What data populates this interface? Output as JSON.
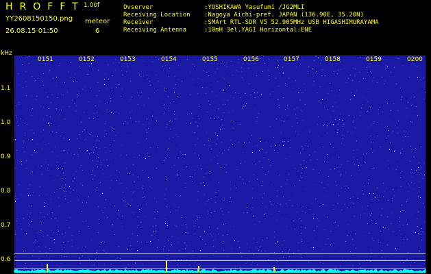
{
  "header": {
    "app_title": "HROFFT",
    "version": "1.00f",
    "filename": "YY2608150150.png",
    "datetime": "26.08.15 01:50",
    "meteor_label": "meteor",
    "meteor_count": "6"
  },
  "info": [
    {
      "key": "Ovserver",
      "value": ":YOSHIKAWA Yasufumi /JG2MLI"
    },
    {
      "key": "Receiving Location",
      "value": ":Nagoya Aichi-pref. JAPAN (136.90E, 35.20N)"
    },
    {
      "key": "Receiver",
      "value": ":SMArt RTL-SDR V5 52.905MHz USB HIGASHIMURAYAMA"
    },
    {
      "key": "Receiving Antenna",
      "value": ":10mH 3el.YAGI Horizontal:ENE"
    }
  ],
  "axis": {
    "unit": "kHz",
    "y_ticks": [
      "1.1",
      "1.0",
      "0.9",
      "0.8",
      "0.7",
      "0.6"
    ],
    "x_ticks": [
      "0151",
      "0152",
      "0153",
      "0154",
      "0155",
      "0156",
      "0157",
      "0158",
      "0159",
      "0200"
    ]
  },
  "colors": {
    "background": "#000000",
    "text": "#ffff00",
    "noise": "#1a1aa6",
    "spectrum": "#00ffff"
  }
}
